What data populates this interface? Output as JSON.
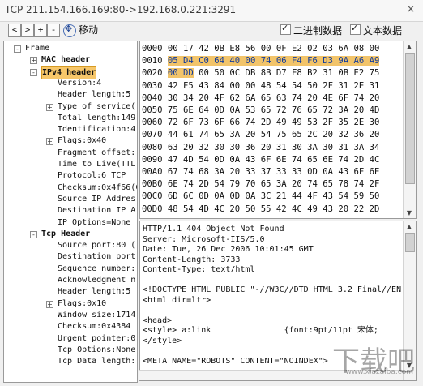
{
  "window": {
    "title": "TCP 211.154.166.169:80->192.168.0.221:3291",
    "close_glyph": "×"
  },
  "toolbar": {
    "buttons": [
      "<",
      ">",
      "+",
      "-"
    ],
    "move_label": "移动",
    "binary_label": "二进制数据",
    "text_label": "文本数据"
  },
  "tree": [
    {
      "label": "Frame",
      "level": 0,
      "exp": "-",
      "bold": false
    },
    {
      "label": "MAC header",
      "level": 1,
      "exp": "+",
      "bold": true
    },
    {
      "label": "IPv4 header",
      "level": 1,
      "exp": "-",
      "bold": true,
      "selected": true
    },
    {
      "label": "Version:4",
      "level": 2
    },
    {
      "label": "Header length:5 (",
      "level": 2
    },
    {
      "label": "Type of service(",
      "level": 2,
      "exp": "+"
    },
    {
      "label": "Total length:149",
      "level": 2
    },
    {
      "label": "Identification:4",
      "level": 2
    },
    {
      "label": "Flags:0x40",
      "level": 2,
      "exp": "+"
    },
    {
      "label": "Fragment offset:",
      "level": 2
    },
    {
      "label": "Time to Live(TTL",
      "level": 2
    },
    {
      "label": "Protocol:6 TCP",
      "level": 2
    },
    {
      "label": "Checksum:0x4f66(C",
      "level": 2
    },
    {
      "label": "Source IP Addres",
      "level": 2
    },
    {
      "label": "Destination IP A",
      "level": 2
    },
    {
      "label": "IP Options=None",
      "level": 2
    },
    {
      "label": "Tcp Header",
      "level": 1,
      "exp": "-",
      "bold": true
    },
    {
      "label": "Source port:80 (",
      "level": 2
    },
    {
      "label": "Destination port",
      "level": 2
    },
    {
      "label": "Sequence number:",
      "level": 2
    },
    {
      "label": "Acknowledgment n",
      "level": 2
    },
    {
      "label": "Header length:5",
      "level": 2
    },
    {
      "label": "Flags:0x10",
      "level": 2,
      "exp": "+"
    },
    {
      "label": "Window size:1714",
      "level": 2
    },
    {
      "label": "Checksum:0x4384",
      "level": 2
    },
    {
      "label": "Urgent pointer:0",
      "level": 2
    },
    {
      "label": "Tcp Options:None",
      "level": 2
    },
    {
      "label": "Tcp Data length:",
      "level": 2
    }
  ],
  "hex_rows": [
    {
      "addr": "0000",
      "pre": "00 17 42 0B E8 56 00 0F E2 02 03 6A 08 00",
      "hl": "",
      "post": ""
    },
    {
      "addr": "0010",
      "pre": "",
      "hl": "05 D4 C0 64 40 00 74 06 F4 F6 D3 9A A6 A9",
      "post": ""
    },
    {
      "addr": "0020",
      "pre": "",
      "hl": "00 DD",
      "post": " 00 50 0C DB 8B D7 F8 B2 31 0B E2 75"
    },
    {
      "addr": "0030",
      "pre": "42 F5 43 84 00 00 48 54 54 50 2F 31 2E 31",
      "hl": "",
      "post": ""
    },
    {
      "addr": "0040",
      "pre": "30 34 20 4F 62 6A 65 63 74 20 4E 6F 74 20",
      "hl": "",
      "post": ""
    },
    {
      "addr": "0050",
      "pre": "75 6E 64 0D 0A 53 65 72 76 65 72 3A 20 4D",
      "hl": "",
      "post": ""
    },
    {
      "addr": "0060",
      "pre": "72 6F 73 6F 66 74 2D 49 49 53 2F 35 2E 30",
      "hl": "",
      "post": ""
    },
    {
      "addr": "0070",
      "pre": "44 61 74 65 3A 20 54 75 65 2C 20 32 36 20",
      "hl": "",
      "post": ""
    },
    {
      "addr": "0080",
      "pre": "63 20 32 30 30 36 20 31 30 3A 30 31 3A 34",
      "hl": "",
      "post": ""
    },
    {
      "addr": "0090",
      "pre": "47 4D 54 0D 0A 43 6F 6E 74 65 6E 74 2D 4C",
      "hl": "",
      "post": ""
    },
    {
      "addr": "00A0",
      "pre": "67 74 68 3A 20 33 37 33 33 0D 0A 43 6F 6E",
      "hl": "",
      "post": ""
    },
    {
      "addr": "00B0",
      "pre": "6E 74 2D 54 79 70 65 3A 20 74 65 78 74 2F",
      "hl": "",
      "post": ""
    },
    {
      "addr": "00C0",
      "pre": "6D 6C 0D 0A 0D 0A 3C 21 44 4F 43 54 59 50",
      "hl": "",
      "post": ""
    },
    {
      "addr": "00D0",
      "pre": "48 54 4D 4C 20 50 55 42 4C 49 43 20 22 2D",
      "hl": "",
      "post": ""
    }
  ],
  "text_lines": [
    "HTTP/1.1 404 Object Not Found",
    "Server: Microsoft-IIS/5.0",
    "Date: Tue, 26 Dec 2006 10:01:45 GMT",
    "Content-Length: 3733",
    "Content-Type: text/html",
    "",
    "<!DOCTYPE HTML PUBLIC \"-//W3C//DTD HTML 3.2 Final//EN",
    "<html dir=ltr>",
    "",
    "<head>",
    "<style> a:link               {font:9pt/11pt 宋体;",
    "</style>",
    "",
    "<META NAME=\"ROBOTS\" CONTENT=\"NOINDEX\">"
  ],
  "watermark": {
    "text": "下载吧",
    "sub": "www.xiazaiba.com"
  }
}
